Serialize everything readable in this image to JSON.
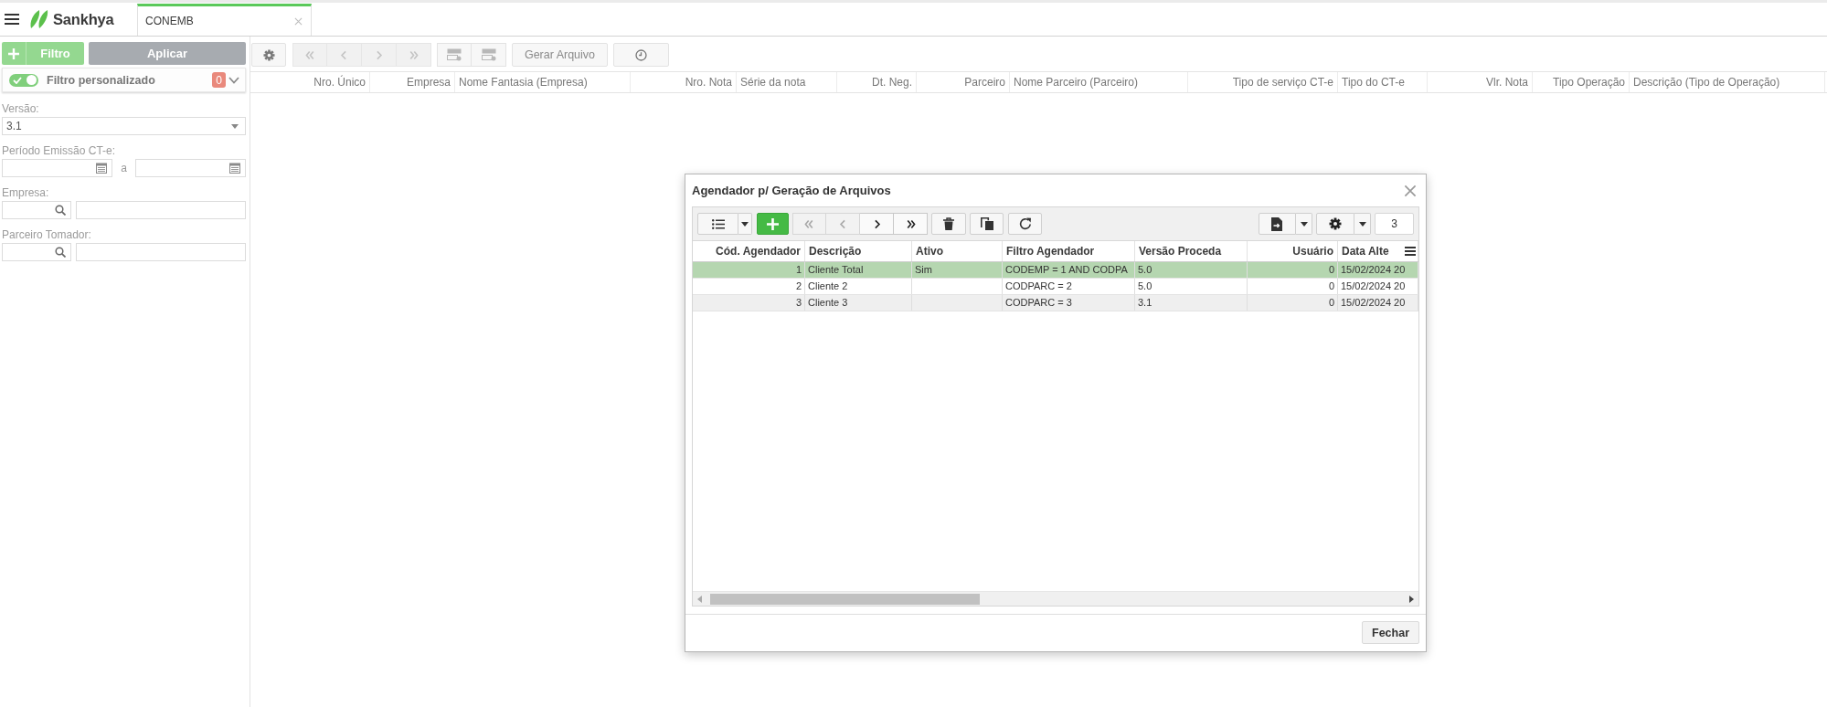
{
  "header": {
    "brand": "Sankhya",
    "tabs": [
      {
        "label": "CONEMB",
        "selected": true
      }
    ]
  },
  "filter_panel": {
    "filter_button": "Filtro",
    "apply_button": "Aplicar",
    "custom_filter": {
      "label": "Filtro personalizado",
      "on": true,
      "count": "0"
    },
    "fields": [
      {
        "kind": "select",
        "label": "Versão:",
        "value": "3.1"
      },
      {
        "kind": "date_range",
        "label": "Período Emissão CT-e:",
        "separator": "a"
      },
      {
        "kind": "lookup",
        "label": "Empresa:"
      },
      {
        "kind": "lookup",
        "label": "Parceiro Tomador:"
      }
    ]
  },
  "toolbar": {
    "nav_buttons": [
      {
        "disabled": true
      },
      {
        "disabled": true
      },
      {
        "disabled": true
      },
      {
        "disabled": true
      }
    ],
    "generate_button": "Gerar Arquivo"
  },
  "table": {
    "columns": [
      {
        "label": "Nro. Único",
        "kind": "numeric"
      },
      {
        "label": "Empresa",
        "kind": "numeric"
      },
      {
        "label": "Nome Fantasia (Empresa)",
        "kind": "text"
      },
      {
        "label": "Nro. Nota",
        "kind": "numeric"
      },
      {
        "label": "Série da nota",
        "kind": "text"
      },
      {
        "label": "Dt. Neg.",
        "kind": "numeric"
      },
      {
        "label": "Parceiro",
        "kind": "numeric"
      },
      {
        "label": "Nome Parceiro (Parceiro)",
        "kind": "text"
      },
      {
        "label": "Tipo de serviço CT-e",
        "kind": "numeric"
      },
      {
        "label": "Tipo do CT-e",
        "kind": "text"
      },
      {
        "label": "Vlr. Nota",
        "kind": "numeric"
      },
      {
        "label": "Tipo Operação",
        "kind": "numeric"
      },
      {
        "label": "Descrição (Tipo de Operação)",
        "kind": "text"
      }
    ]
  },
  "dialog": {
    "title": "Agendador p/ Geração de Arquivos",
    "toolbar": {
      "nav_buttons": [
        {
          "disabled": true
        },
        {
          "disabled": true
        },
        {
          "disabled": false
        },
        {
          "disabled": false
        }
      ],
      "record_count": "3"
    },
    "table": {
      "columns": [
        {
          "label": "Cód. Agendador",
          "kind": "numeric"
        },
        {
          "label": "Descrição",
          "kind": "text"
        },
        {
          "label": "Ativo",
          "kind": "text"
        },
        {
          "label": "Filtro Agendador",
          "kind": "text"
        },
        {
          "label": "Versão Proceda",
          "kind": "text"
        },
        {
          "label": "Usuário",
          "kind": "numeric"
        },
        {
          "label": "Data Alte",
          "kind": "text"
        }
      ],
      "rows": [
        {
          "selected": true,
          "code": "1",
          "description": "Cliente Total",
          "active": "Sim",
          "filter": "CODEMP = 1 AND CODPA",
          "version": "5.0",
          "user": "0",
          "date": "15/02/2024 20"
        },
        {
          "selected": false,
          "code": "2",
          "description": "Cliente 2",
          "filter": "CODPARC = 2",
          "version": "5.0",
          "user": "0",
          "date": "15/02/2024 20"
        },
        {
          "selected": false,
          "code": "3",
          "description": "Cliente 3",
          "filter": "CODPARC = 3",
          "version": "3.1",
          "user": "0",
          "date": "15/02/2024 20"
        }
      ]
    },
    "close_button": "Fechar"
  }
}
